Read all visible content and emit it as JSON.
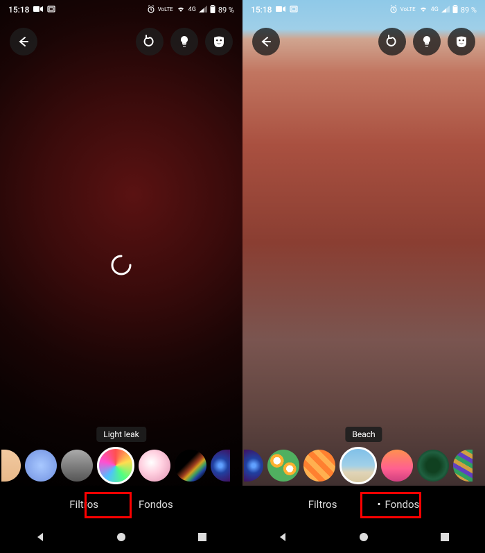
{
  "status": {
    "time": "15:18",
    "battery": "89 %",
    "network_label": "LTE"
  },
  "screens": [
    {
      "side": "left",
      "selected_filter_label": "Light leak",
      "tabs": {
        "filtros": "Filtros",
        "fondos": "Fondos",
        "active": "filtros"
      },
      "highlight_tab": "filtros",
      "loading": true
    },
    {
      "side": "right",
      "selected_filter_label": "Beach",
      "tabs": {
        "filtros": "Filtros",
        "fondos": "Fondos",
        "active": "fondos"
      },
      "highlight_tab": "fondos",
      "loading": false
    }
  ]
}
